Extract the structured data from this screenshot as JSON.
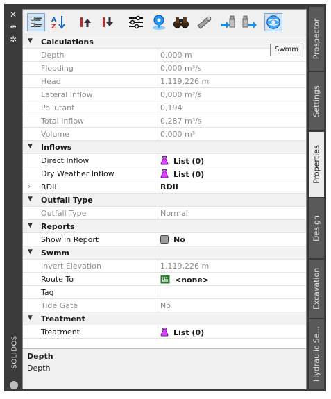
{
  "left_bar": {
    "icons": [
      "close-icon",
      "pin-icon",
      "settings-icon"
    ],
    "title": "SOLIDOS"
  },
  "toolbar": {
    "buttons": [
      {
        "name": "categorized-view-button",
        "icon": "list-icon",
        "selected": true
      },
      {
        "name": "alphabetical-sort-button",
        "icon": "sort-az-icon",
        "selected": false
      },
      {
        "name": "move-up-button",
        "icon": "arrow-up-icon",
        "selected": false
      },
      {
        "name": "move-down-button",
        "icon": "arrow-down-icon",
        "selected": false
      },
      {
        "name": "adjust-button",
        "icon": "sliders-icon",
        "selected": false
      },
      {
        "name": "locate-button",
        "icon": "pin-icon",
        "selected": false
      },
      {
        "name": "zoom-to-button",
        "icon": "binoculars-icon",
        "selected": false
      },
      {
        "name": "pipe-button",
        "icon": "pipe-icon",
        "selected": false
      },
      {
        "name": "import-button",
        "icon": "import-icon",
        "selected": false
      },
      {
        "name": "export-button",
        "icon": "export-icon",
        "selected": false
      },
      {
        "name": "swmm-button",
        "icon": "swmm-globe-icon",
        "selected": true
      }
    ],
    "tooltip": "Swmm"
  },
  "properties": {
    "calculations": {
      "title": "Calculations",
      "rows": [
        {
          "label": "Depth",
          "value": "0,000 m"
        },
        {
          "label": "Flooding",
          "value": "0,000 m³/s"
        },
        {
          "label": "Head",
          "value": "1.119,226 m"
        },
        {
          "label": "Lateral Inflow",
          "value": "0,000 m³/s"
        },
        {
          "label": "Pollutant",
          "value": "0,194"
        },
        {
          "label": "Total Inflow",
          "value": "0,287 m³/s"
        },
        {
          "label": "Volume",
          "value": "0,000 m³"
        }
      ]
    },
    "inflows": {
      "title": "Inflows",
      "direct_label": "Direct Inflow",
      "direct_value": "List (0)",
      "dry_label": "Dry Weather Inflow",
      "dry_value": "List (0)",
      "rdii_label": "RDII",
      "rdii_value": "RDII"
    },
    "outfall_type": {
      "title": "Outfall Type",
      "label": "Outfall Type",
      "value": "Normal"
    },
    "reports": {
      "title": "Reports",
      "label": "Show in Report",
      "value": "No"
    },
    "swmm": {
      "title": "Swmm",
      "invert_label": "Invert Elevation",
      "invert_value": "1.119,226 m",
      "route_label": "Route To",
      "route_value": "<none>",
      "tag_label": "Tag",
      "tag_value": "",
      "tide_label": "Tide Gate",
      "tide_value": "No"
    },
    "treatment": {
      "title": "Treatment",
      "label": "Treatment",
      "value": "List (0)"
    }
  },
  "description": {
    "title": "Depth",
    "text": "Depth"
  },
  "tabs": [
    {
      "label": "Prospector",
      "active": false
    },
    {
      "label": "Settings",
      "active": false
    },
    {
      "label": "Properties",
      "active": true
    },
    {
      "label": "Design",
      "active": false
    },
    {
      "label": "Excavation",
      "active": false
    },
    {
      "label": "Hydraulic Se...",
      "active": false
    }
  ],
  "colors": {
    "panel_dark": "#3b3b3b",
    "tab_inactive": "#595959",
    "tab_active": "#ececec",
    "category_bg": "#f2f2f2",
    "readonly_text": "#8c8c8c",
    "selection_blue": "#cfe3f7"
  }
}
